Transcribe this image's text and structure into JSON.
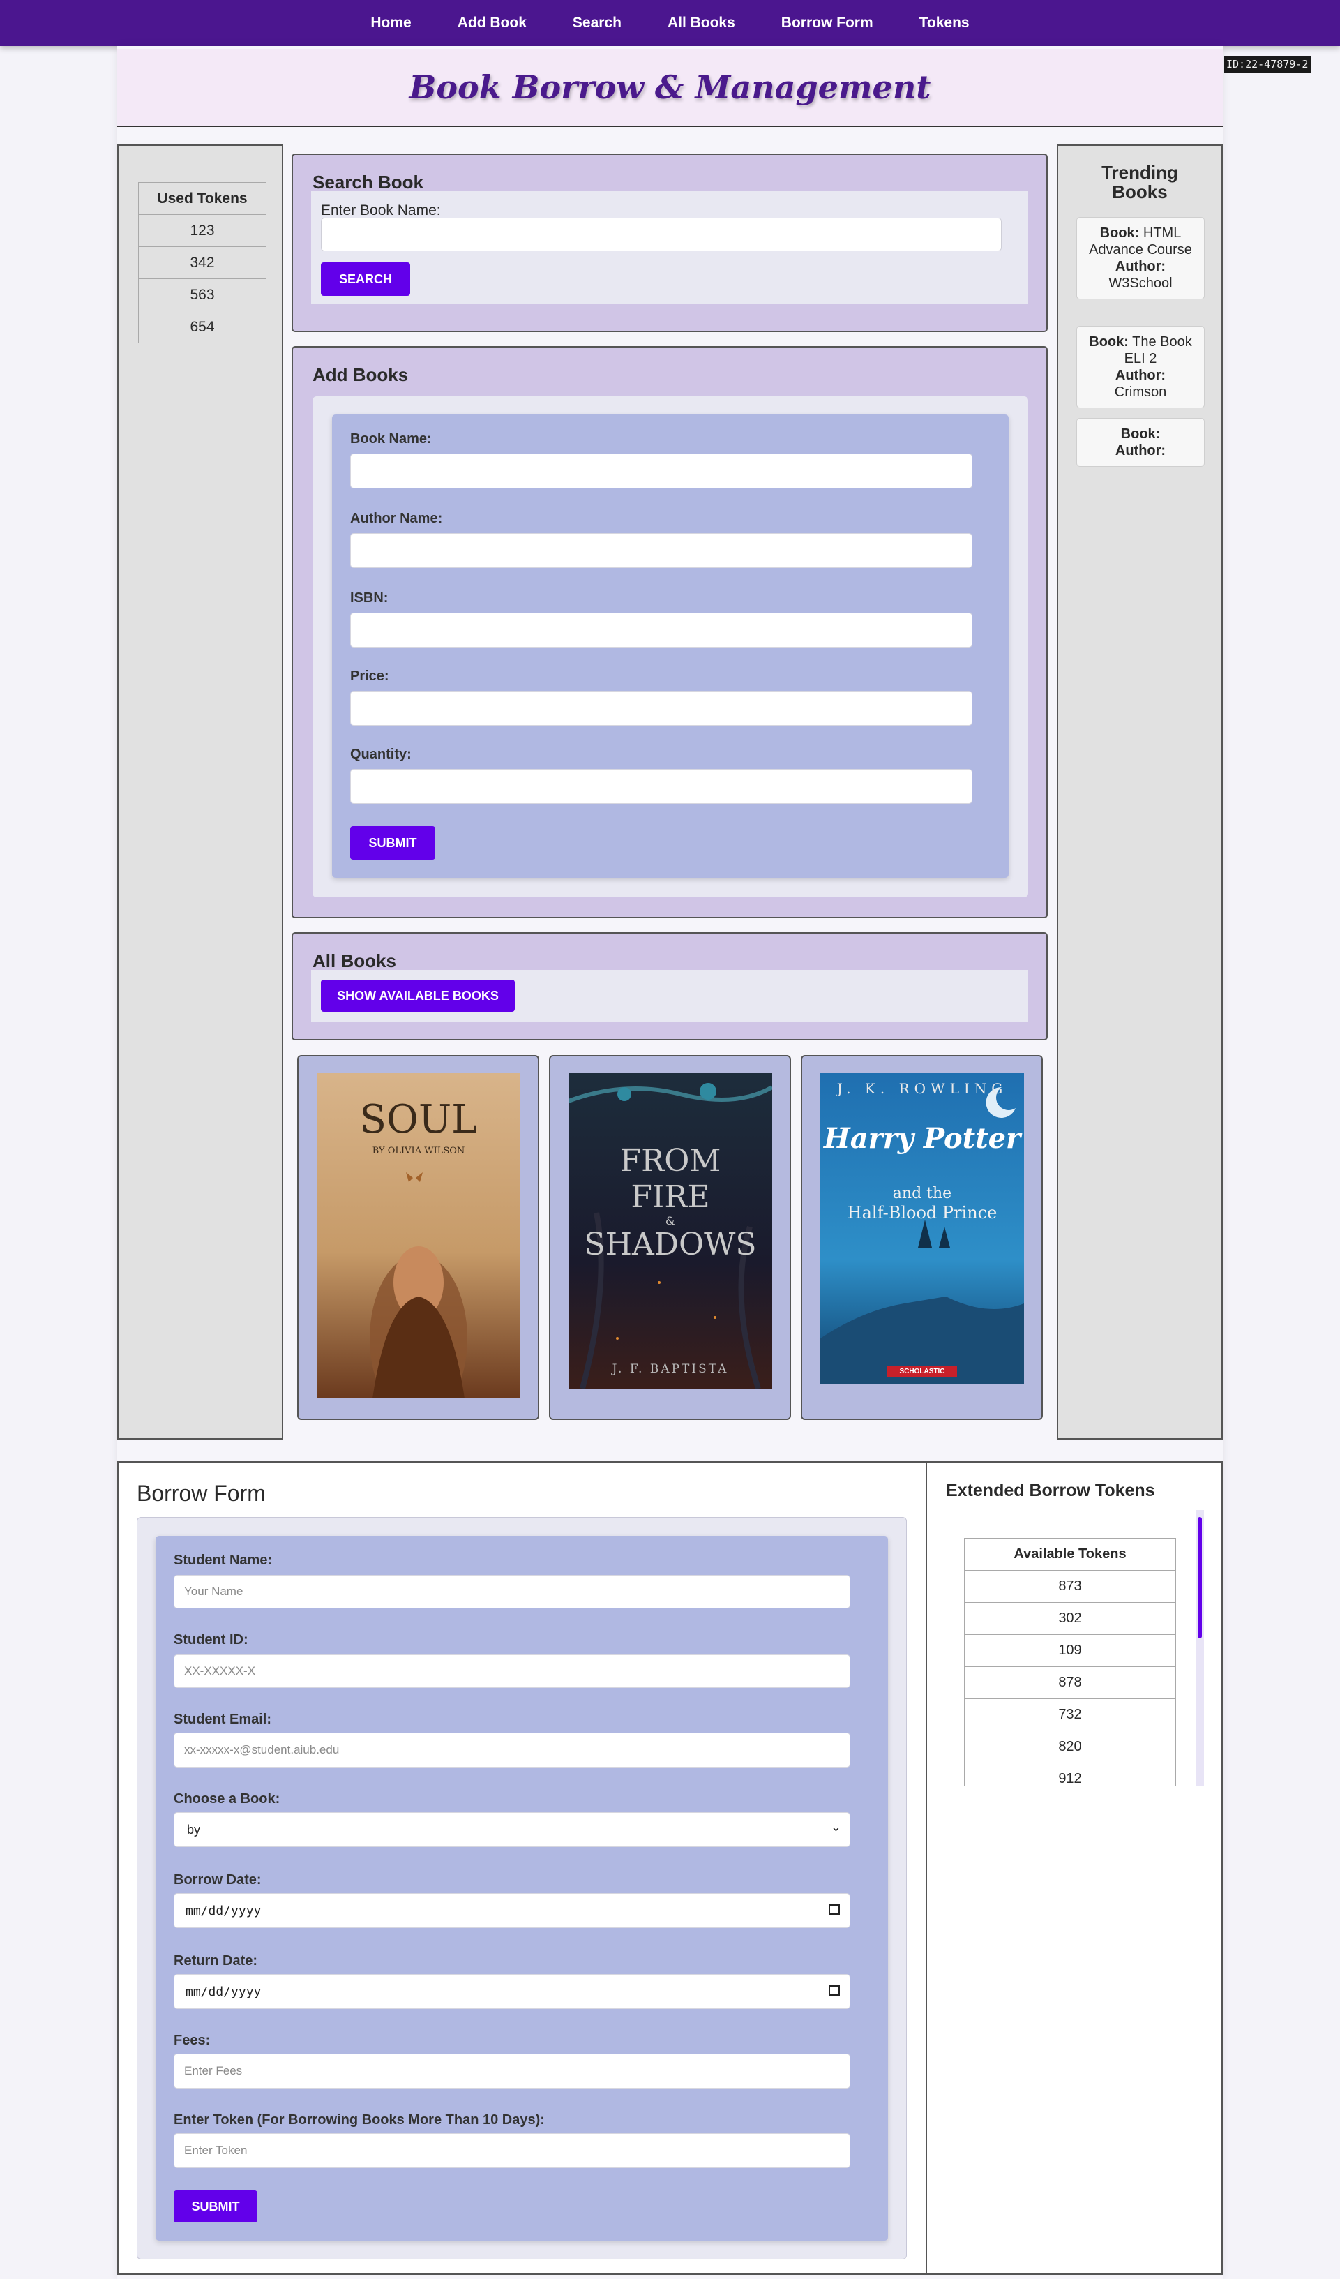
{
  "nav": {
    "items": [
      "Home",
      "Add Book",
      "Search",
      "All Books",
      "Borrow Form",
      "Tokens"
    ]
  },
  "id_tag": "ID:22-47879-2",
  "header": {
    "title": "Book Borrow & Management"
  },
  "used_tokens": {
    "header": "Used Tokens",
    "values": [
      "123",
      "342",
      "563",
      "654"
    ]
  },
  "trending": {
    "title": "Trending Books",
    "book_label": "Book:",
    "author_label": "Author:",
    "items": [
      {
        "book": "HTML Advance Course",
        "author": "W3School"
      },
      {
        "book": "The Book ELI 2",
        "author": "Crimson"
      },
      {
        "book": "",
        "author": ""
      }
    ]
  },
  "search": {
    "title": "Search Book",
    "label": "Enter Book Name:",
    "value": "",
    "button": "SEARCH"
  },
  "add_books": {
    "title": "Add Books",
    "fields": [
      "Book Name:",
      "Author Name:",
      "ISBN:",
      "Price:",
      "Quantity:"
    ],
    "button": "SUBMIT"
  },
  "all_books": {
    "title": "All Books",
    "button": "SHOW AVAILABLE BOOKS"
  },
  "covers": [
    {
      "title": "SOUL",
      "author": "BY OLIVIA WILSON"
    },
    {
      "title_lines": [
        "FROM",
        "FIRE",
        "SHADOWS"
      ],
      "amp": "&",
      "author": "J. F. BAPTISTA"
    },
    {
      "author": "J. K. ROWLING",
      "title_lines": [
        "Harry Potter",
        "and the",
        "Half-Blood Prince"
      ],
      "publisher": "SCHOLASTIC"
    }
  ],
  "borrow": {
    "title": "Borrow Form",
    "fields": [
      {
        "label": "Student Name:",
        "placeholder": "Your Name"
      },
      {
        "label": "Student ID:",
        "placeholder": "XX-XXXXX-X"
      },
      {
        "label": "Student Email:",
        "placeholder": "xx-xxxxx-x@student.aiub.edu"
      },
      {
        "label": "Choose a Book:",
        "value": "by"
      },
      {
        "label": "Borrow Date:",
        "value": "mm/dd/yyyy"
      },
      {
        "label": "Return Date:",
        "value": "mm/dd/yyyy"
      },
      {
        "label": "Fees:",
        "placeholder": "Enter Fees"
      },
      {
        "label": "Enter Token (For Borrowing Books More Than 10 Days):",
        "placeholder": "Enter Token"
      }
    ],
    "button": "SUBMIT"
  },
  "extended": {
    "title": "Extended Borrow Tokens",
    "header": "Available Tokens",
    "values": [
      "873",
      "302",
      "109",
      "878",
      "732",
      "820",
      "912"
    ]
  },
  "colors": {
    "nav": "#4b168f",
    "accent_button": "#6200ea",
    "panel": "#d0c5e6",
    "form": "#b0b8e2"
  }
}
